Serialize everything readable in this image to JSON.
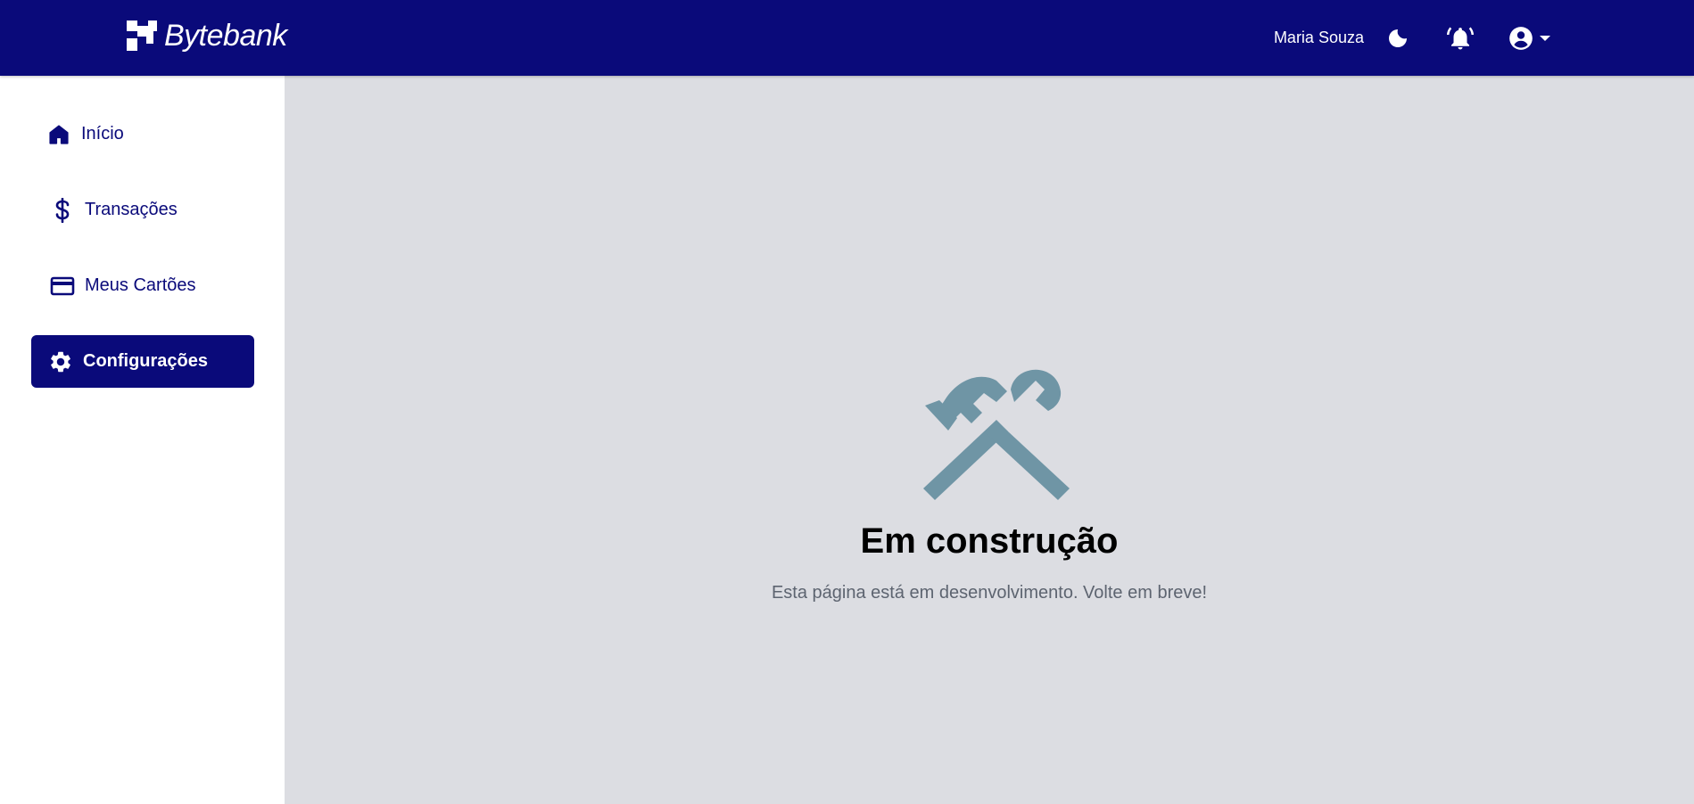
{
  "header": {
    "brand": "Bytebank",
    "user_name": "Maria Souza",
    "icons": {
      "theme": "moon-icon",
      "notifications": "bell-ringing-icon",
      "account": "account-circle-icon",
      "dropdown": "caret-down-icon"
    }
  },
  "sidebar": {
    "items": [
      {
        "label": "Início",
        "icon": "home-icon",
        "active": false
      },
      {
        "label": "Transações",
        "icon": "dollar-icon",
        "active": false
      },
      {
        "label": "Meus Cartões",
        "icon": "credit-card-icon",
        "active": false
      },
      {
        "label": "Configurações",
        "icon": "gear-icon",
        "active": true
      }
    ]
  },
  "main": {
    "icon": "hammer-wrench-icon",
    "title": "Em construção",
    "subtitle": "Esta página está em desenvolvimento. Volte em breve!"
  },
  "colors": {
    "primary": "#0a0a7a",
    "background": "#dcdde2",
    "construction_icon": "#6f95a5",
    "subtitle_text": "#5d6470"
  }
}
